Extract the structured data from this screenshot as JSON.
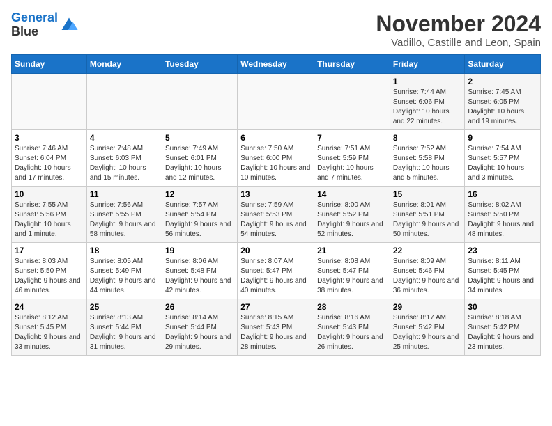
{
  "header": {
    "logo_line1": "General",
    "logo_line2": "Blue",
    "month_title": "November 2024",
    "location": "Vadillo, Castille and Leon, Spain"
  },
  "weekdays": [
    "Sunday",
    "Monday",
    "Tuesday",
    "Wednesday",
    "Thursday",
    "Friday",
    "Saturday"
  ],
  "weeks": [
    [
      {
        "day": "",
        "info": ""
      },
      {
        "day": "",
        "info": ""
      },
      {
        "day": "",
        "info": ""
      },
      {
        "day": "",
        "info": ""
      },
      {
        "day": "",
        "info": ""
      },
      {
        "day": "1",
        "info": "Sunrise: 7:44 AM\nSunset: 6:06 PM\nDaylight: 10 hours and 22 minutes."
      },
      {
        "day": "2",
        "info": "Sunrise: 7:45 AM\nSunset: 6:05 PM\nDaylight: 10 hours and 19 minutes."
      }
    ],
    [
      {
        "day": "3",
        "info": "Sunrise: 7:46 AM\nSunset: 6:04 PM\nDaylight: 10 hours and 17 minutes."
      },
      {
        "day": "4",
        "info": "Sunrise: 7:48 AM\nSunset: 6:03 PM\nDaylight: 10 hours and 15 minutes."
      },
      {
        "day": "5",
        "info": "Sunrise: 7:49 AM\nSunset: 6:01 PM\nDaylight: 10 hours and 12 minutes."
      },
      {
        "day": "6",
        "info": "Sunrise: 7:50 AM\nSunset: 6:00 PM\nDaylight: 10 hours and 10 minutes."
      },
      {
        "day": "7",
        "info": "Sunrise: 7:51 AM\nSunset: 5:59 PM\nDaylight: 10 hours and 7 minutes."
      },
      {
        "day": "8",
        "info": "Sunrise: 7:52 AM\nSunset: 5:58 PM\nDaylight: 10 hours and 5 minutes."
      },
      {
        "day": "9",
        "info": "Sunrise: 7:54 AM\nSunset: 5:57 PM\nDaylight: 10 hours and 3 minutes."
      }
    ],
    [
      {
        "day": "10",
        "info": "Sunrise: 7:55 AM\nSunset: 5:56 PM\nDaylight: 10 hours and 1 minute."
      },
      {
        "day": "11",
        "info": "Sunrise: 7:56 AM\nSunset: 5:55 PM\nDaylight: 9 hours and 58 minutes."
      },
      {
        "day": "12",
        "info": "Sunrise: 7:57 AM\nSunset: 5:54 PM\nDaylight: 9 hours and 56 minutes."
      },
      {
        "day": "13",
        "info": "Sunrise: 7:59 AM\nSunset: 5:53 PM\nDaylight: 9 hours and 54 minutes."
      },
      {
        "day": "14",
        "info": "Sunrise: 8:00 AM\nSunset: 5:52 PM\nDaylight: 9 hours and 52 minutes."
      },
      {
        "day": "15",
        "info": "Sunrise: 8:01 AM\nSunset: 5:51 PM\nDaylight: 9 hours and 50 minutes."
      },
      {
        "day": "16",
        "info": "Sunrise: 8:02 AM\nSunset: 5:50 PM\nDaylight: 9 hours and 48 minutes."
      }
    ],
    [
      {
        "day": "17",
        "info": "Sunrise: 8:03 AM\nSunset: 5:50 PM\nDaylight: 9 hours and 46 minutes."
      },
      {
        "day": "18",
        "info": "Sunrise: 8:05 AM\nSunset: 5:49 PM\nDaylight: 9 hours and 44 minutes."
      },
      {
        "day": "19",
        "info": "Sunrise: 8:06 AM\nSunset: 5:48 PM\nDaylight: 9 hours and 42 minutes."
      },
      {
        "day": "20",
        "info": "Sunrise: 8:07 AM\nSunset: 5:47 PM\nDaylight: 9 hours and 40 minutes."
      },
      {
        "day": "21",
        "info": "Sunrise: 8:08 AM\nSunset: 5:47 PM\nDaylight: 9 hours and 38 minutes."
      },
      {
        "day": "22",
        "info": "Sunrise: 8:09 AM\nSunset: 5:46 PM\nDaylight: 9 hours and 36 minutes."
      },
      {
        "day": "23",
        "info": "Sunrise: 8:11 AM\nSunset: 5:45 PM\nDaylight: 9 hours and 34 minutes."
      }
    ],
    [
      {
        "day": "24",
        "info": "Sunrise: 8:12 AM\nSunset: 5:45 PM\nDaylight: 9 hours and 33 minutes."
      },
      {
        "day": "25",
        "info": "Sunrise: 8:13 AM\nSunset: 5:44 PM\nDaylight: 9 hours and 31 minutes."
      },
      {
        "day": "26",
        "info": "Sunrise: 8:14 AM\nSunset: 5:44 PM\nDaylight: 9 hours and 29 minutes."
      },
      {
        "day": "27",
        "info": "Sunrise: 8:15 AM\nSunset: 5:43 PM\nDaylight: 9 hours and 28 minutes."
      },
      {
        "day": "28",
        "info": "Sunrise: 8:16 AM\nSunset: 5:43 PM\nDaylight: 9 hours and 26 minutes."
      },
      {
        "day": "29",
        "info": "Sunrise: 8:17 AM\nSunset: 5:42 PM\nDaylight: 9 hours and 25 minutes."
      },
      {
        "day": "30",
        "info": "Sunrise: 8:18 AM\nSunset: 5:42 PM\nDaylight: 9 hours and 23 minutes."
      }
    ]
  ]
}
